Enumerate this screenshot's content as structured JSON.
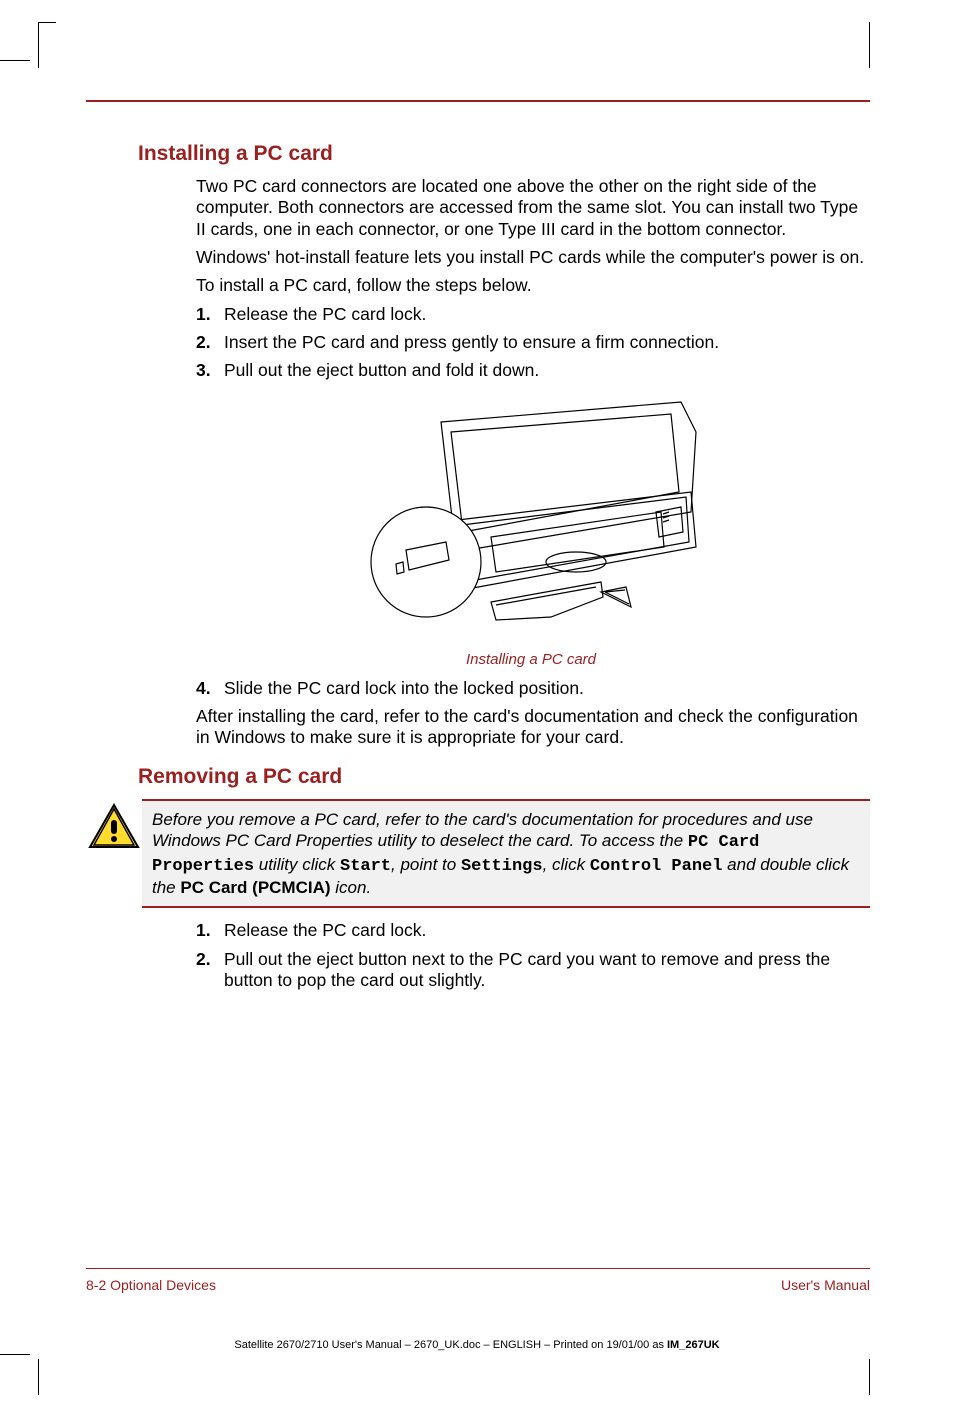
{
  "section1": {
    "heading": "Installing a PC card",
    "p1": "Two PC card connectors are located one above the other on the right side of the computer. Both connectors are accessed from the same slot. You can install two Type II cards, one in each connector, or one Type III card in the bottom connector.",
    "p2": "Windows' hot-install feature lets you install PC cards while the computer's power is on.",
    "p3": "To install a PC card, follow the steps below.",
    "steps_a": [
      "Release the PC card lock.",
      "Insert the PC card and press gently to ensure a firm connection.",
      "Pull out the eject button and fold it down."
    ],
    "caption": "Installing a PC card",
    "steps_b_start": 4,
    "steps_b": [
      "Slide the PC card lock into the locked position."
    ],
    "p4": "After installing the card, refer to the card's documentation and check the configuration in Windows to make sure it is appropriate for your card."
  },
  "section2": {
    "heading": "Removing a PC card",
    "caution": {
      "t1": "Before you remove a PC card, refer to the card's documentation for procedures and use Windows PC Card Properties utility to deselect the card. To access the ",
      "m1": "PC Card Properties",
      "t2": " utility click ",
      "m2": "Start",
      "t3": ", point to ",
      "m3": "Settings",
      "t4": ", click ",
      "m4": "Control Panel",
      "t5": " and double click the ",
      "b1": "PC Card (PCMCIA)",
      "t6": " icon."
    },
    "steps": [
      "Release the PC card lock.",
      "Pull out the eject button next to the PC card you want to remove and press the button to pop the card out slightly."
    ]
  },
  "footer": {
    "left": "8-2  Optional Devices",
    "right": "User's Manual"
  },
  "imprint": {
    "text": "Satellite 2670/2710 User's Manual  – 2670_UK.doc – ENGLISH – Printed on 19/01/00 as ",
    "code": "IM_267UK"
  }
}
